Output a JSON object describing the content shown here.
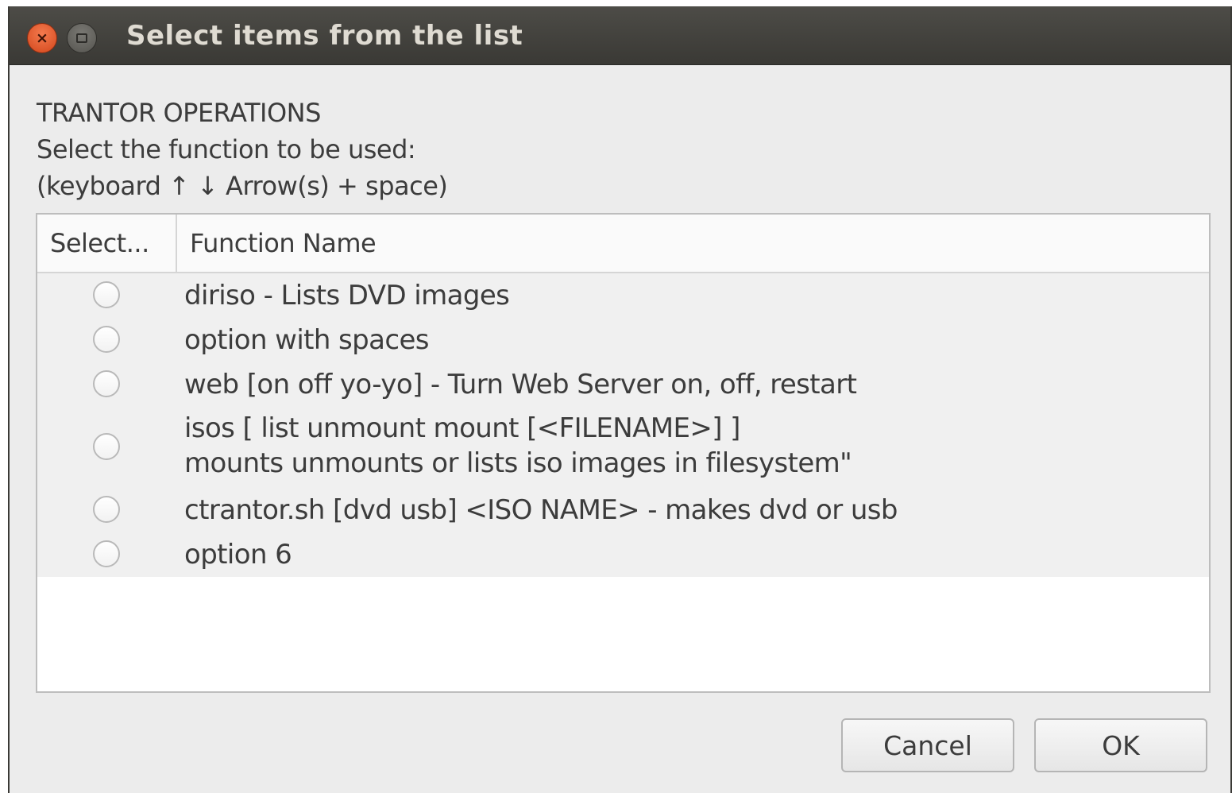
{
  "window": {
    "title": "Select items from the list",
    "close_glyph": "×"
  },
  "prompt": {
    "line1": "TRANTOR OPERATIONS",
    "line2": "Select the function to be used:",
    "line3": "(keyboard ↑  ↓  Arrow(s) + space)"
  },
  "list": {
    "columns": [
      "Select...",
      "Function Name"
    ],
    "rows": [
      {
        "selected": false,
        "lines": [
          "diriso - Lists DVD images"
        ]
      },
      {
        "selected": false,
        "lines": [
          "option with spaces"
        ]
      },
      {
        "selected": false,
        "lines": [
          "web [on off yo-yo] - Turn Web Server on, off, restart"
        ]
      },
      {
        "selected": false,
        "lines": [
          "isos [ list unmount mount [<FILENAME>] ]",
          "mounts unmounts or lists iso images in filesystem\""
        ]
      },
      {
        "selected": false,
        "lines": [
          "ctrantor.sh [dvd usb] <ISO NAME> - makes dvd or usb"
        ]
      },
      {
        "selected": false,
        "lines": [
          "option 6"
        ]
      }
    ]
  },
  "buttons": {
    "cancel": "Cancel",
    "ok": "OK"
  },
  "colors": {
    "titlebar": "#3c3b37",
    "close_button": "#e05a2b",
    "dialog_background": "#ececec",
    "text": "#3c3c3c"
  },
  "icons": {
    "close": "close-icon",
    "maximize": "maximize-icon",
    "radio": "radio-button-icon"
  }
}
